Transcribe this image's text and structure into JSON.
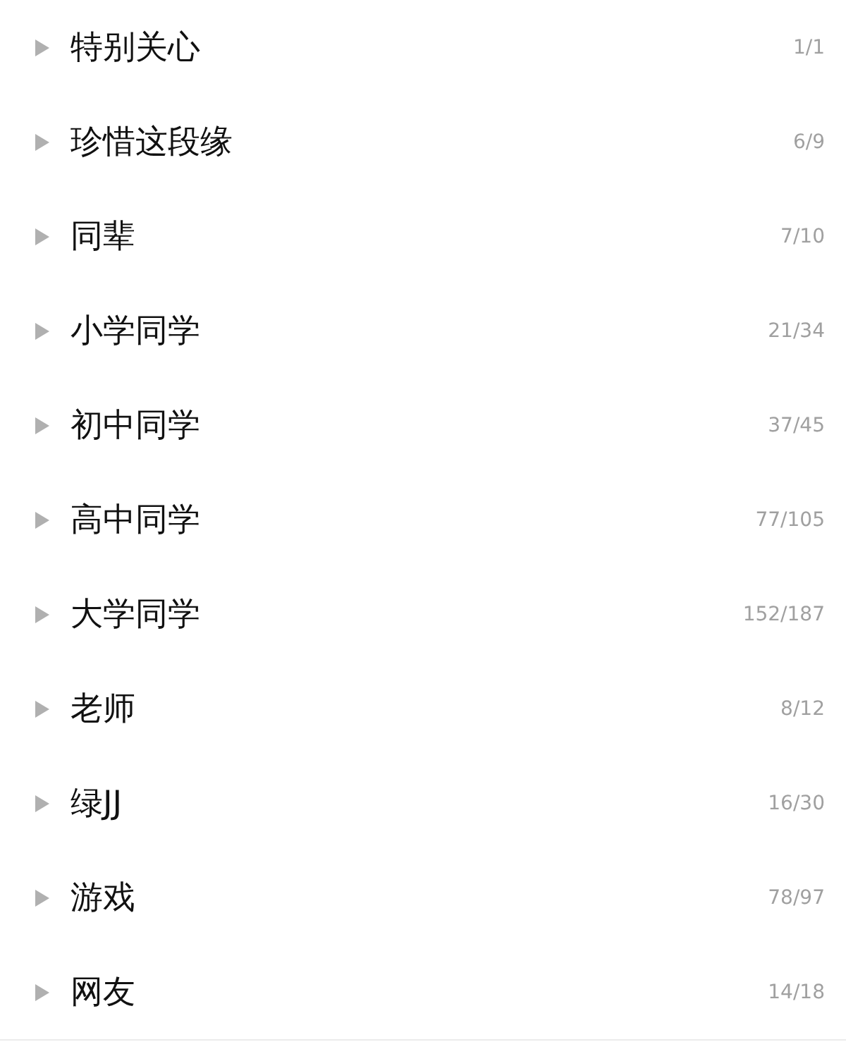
{
  "groups": [
    {
      "name": "特别关心",
      "count": "1/1",
      "expanded": false
    },
    {
      "name": "珍惜这段缘",
      "count": "6/9",
      "expanded": false
    },
    {
      "name": "同辈",
      "count": "7/10",
      "expanded": false
    },
    {
      "name": "小学同学",
      "count": "21/34",
      "expanded": false
    },
    {
      "name": "初中同学",
      "count": "37/45",
      "expanded": false
    },
    {
      "name": "高中同学",
      "count": "77/105",
      "expanded": false
    },
    {
      "name": "大学同学",
      "count": "152/187",
      "expanded": false
    },
    {
      "name": "老师",
      "count": "8/12",
      "expanded": false
    },
    {
      "name": "绿JJ",
      "count": "16/30",
      "expanded": false
    },
    {
      "name": "游戏",
      "count": "78/97",
      "expanded": false
    },
    {
      "name": "网友",
      "count": "14/18",
      "expanded": false
    }
  ]
}
